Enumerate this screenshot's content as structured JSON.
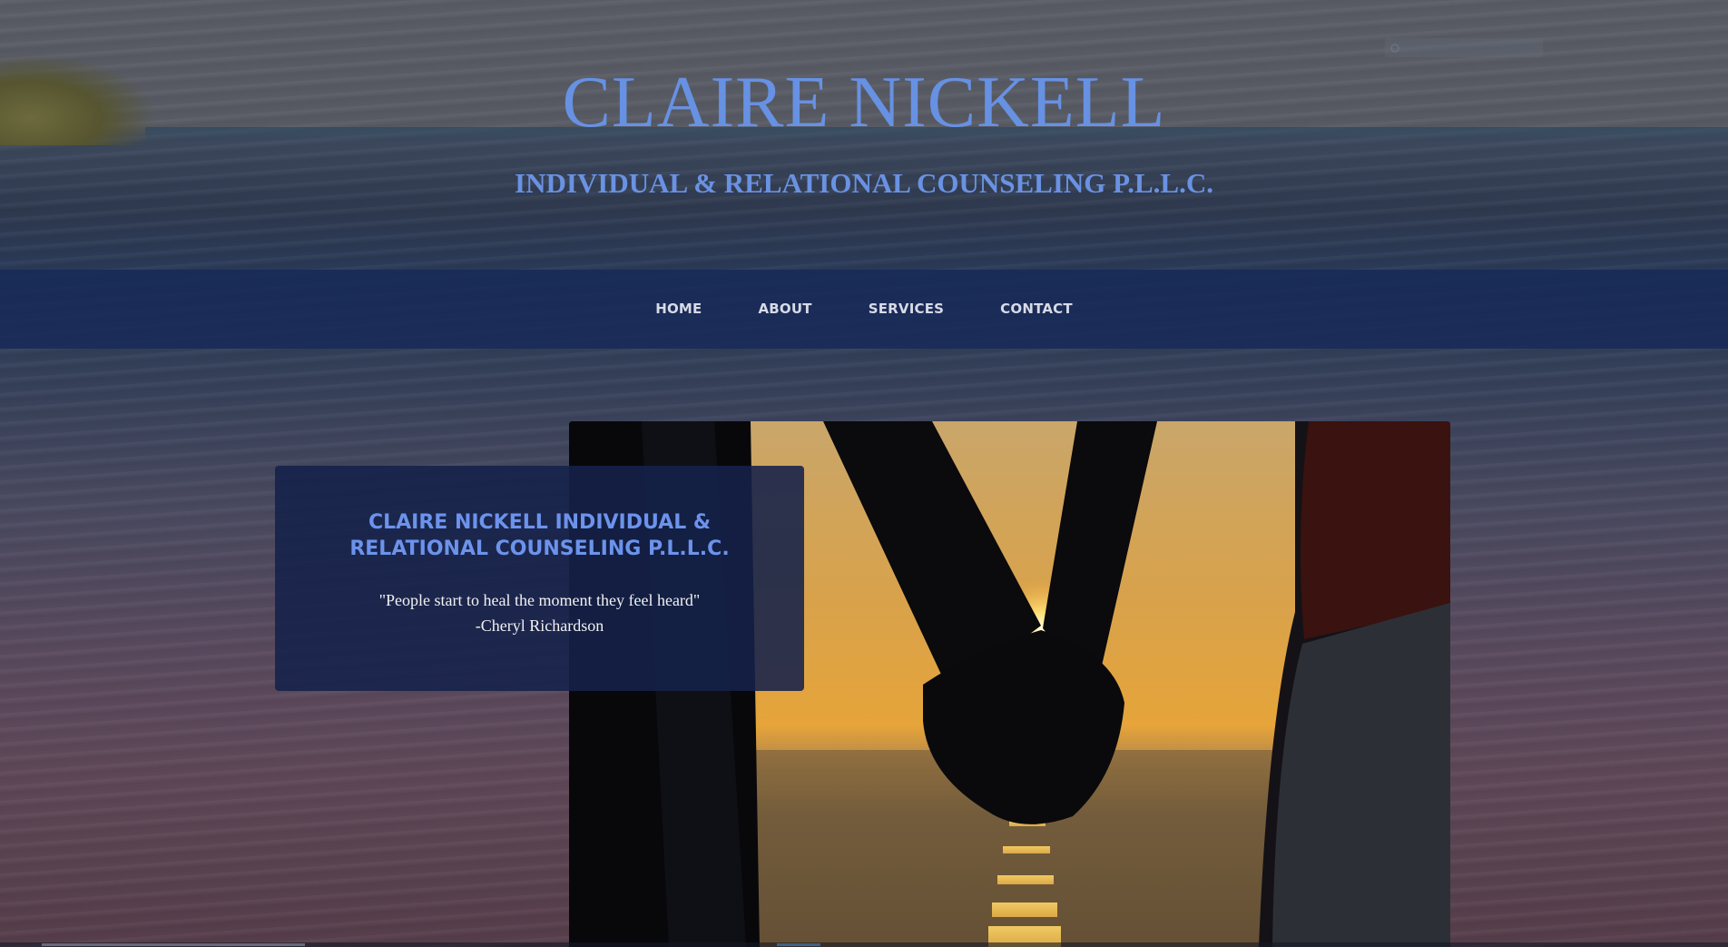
{
  "header": {
    "title": "CLAIRE NICKELL",
    "subtitle": "INDIVIDUAL & RELATIONAL COUNSELING P.L.L.C."
  },
  "search": {
    "placeholder": "",
    "icon": "search-icon"
  },
  "nav": {
    "items": [
      {
        "label": "HOME"
      },
      {
        "label": "ABOUT"
      },
      {
        "label": "SERVICES"
      },
      {
        "label": "CONTACT"
      }
    ]
  },
  "hero": {
    "card_heading": "CLAIRE NICKELL INDIVIDUAL & RELATIONAL COUNSELING P.L.L.C.",
    "quote": "\"People start to heal the moment they feel heard\"",
    "quote_author": "-Cheryl Richardson"
  },
  "colors": {
    "accent_blue": "#6791e3",
    "nav_bg": "#162858",
    "card_bg": "#15214a"
  }
}
